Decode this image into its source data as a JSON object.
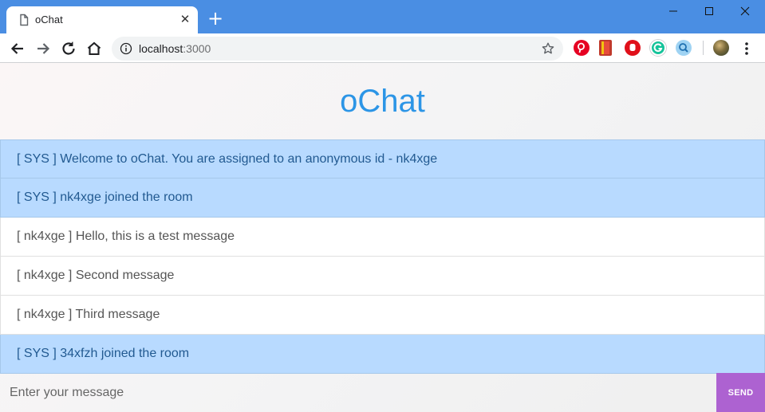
{
  "browser": {
    "tab_title": "oChat",
    "new_tab_label": "+",
    "close_tab_label": "✕",
    "url_host": "localhost",
    "url_port": ":3000",
    "icons": [
      "page-icon",
      "close-icon",
      "plus-icon",
      "minimize-icon",
      "maximize-icon",
      "window-close-icon",
      "back-arrow-icon",
      "forward-arrow-icon",
      "reload-icon",
      "home-icon",
      "info-icon",
      "star-icon",
      "pinterest-icon",
      "bookmark-icon",
      "hand-stop-icon",
      "grammarly-icon",
      "search-extension-icon",
      "profile-avatar",
      "kebab-menu-icon"
    ],
    "colors": {
      "titlebar": "#4a8ee3",
      "omnibox": "#f1f3f4"
    }
  },
  "app": {
    "title": "oChat",
    "messages": [
      {
        "type": "sys",
        "text": "[ SYS ] Welcome to oChat. You are assigned to an anonymous id - nk4xge"
      },
      {
        "type": "sys",
        "text": "[ SYS ] nk4xge joined the room"
      },
      {
        "type": "user",
        "text": "[ nk4xge ] Hello, this is a test message"
      },
      {
        "type": "user",
        "text": "[ nk4xge ] Second message"
      },
      {
        "type": "user",
        "text": "[ nk4xge ] Third message"
      },
      {
        "type": "sys",
        "text": "[ SYS ] 34xfzh joined the room"
      }
    ],
    "input": {
      "placeholder": "Enter your message",
      "value": ""
    },
    "send_label": "SEND",
    "colors": {
      "title": "#2c95e6",
      "sys_bg": "#b8daff",
      "sys_text": "#225a91",
      "send_bg": "#ad62d1"
    }
  }
}
